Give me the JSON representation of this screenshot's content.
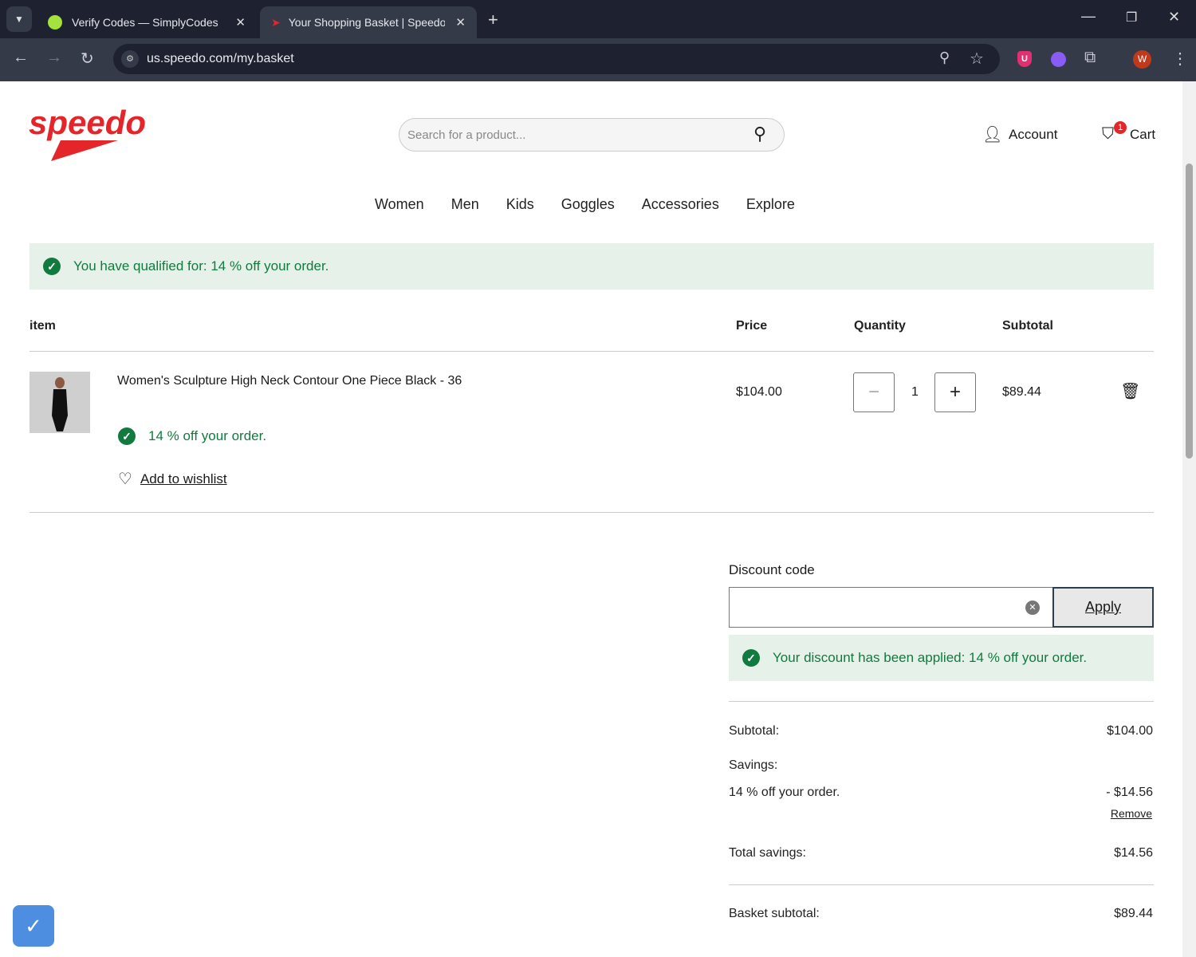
{
  "browser": {
    "tabs": [
      {
        "title": "Verify Codes — SimplyCodes"
      },
      {
        "title": "Your Shopping Basket | Speedo"
      }
    ],
    "url": "us.speedo.com/my.basket",
    "profile_initial": "W",
    "extension_initial": "U"
  },
  "header": {
    "logo": "speedo",
    "search_placeholder": "Search for a product...",
    "account": "Account",
    "cart": "Cart",
    "cart_count": "1"
  },
  "nav": [
    "Women",
    "Men",
    "Kids",
    "Goggles",
    "Accessories",
    "Explore"
  ],
  "qualified_banner": "You have qualified for: 14 % off your order.",
  "table": {
    "headers": {
      "item": "item",
      "price": "Price",
      "quantity": "Quantity",
      "subtotal": "Subtotal"
    },
    "items": [
      {
        "name": "Women's Sculpture High Neck Contour One Piece Black - 36",
        "price": "$104.00",
        "quantity": "1",
        "subtotal": "$89.44",
        "promo": "14 % off your order.",
        "wishlist": "Add to wishlist"
      }
    ]
  },
  "discount": {
    "label": "Discount code",
    "value": "",
    "apply": "Apply",
    "applied_message": "Your discount has been applied: 14 % off your order."
  },
  "summary": {
    "subtotal_label": "Subtotal:",
    "subtotal": "$104.00",
    "savings_label": "Savings:",
    "saving_name": "14 % off your order.",
    "saving_amount": "- $14.56",
    "remove": "Remove",
    "total_savings_label": "Total savings:",
    "total_savings": "$14.56",
    "basket_subtotal_label": "Basket subtotal:",
    "basket_subtotal": "$89.44"
  },
  "colors": {
    "brand": "#e4262b",
    "success": "#117a3e",
    "banner_bg": "#e6f2e9"
  }
}
